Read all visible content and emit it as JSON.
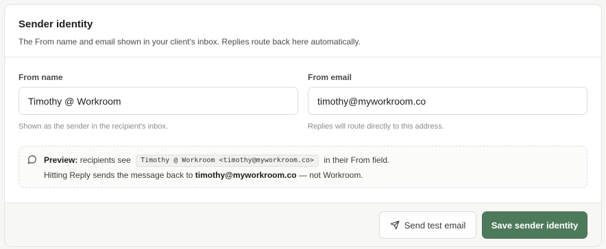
{
  "header": {
    "title": "Sender identity",
    "description": "The From name and email shown in your client's inbox. Replies route back here automatically."
  },
  "from_name": {
    "label": "From name",
    "value": "Timothy @ Workroom",
    "hint": "Shown as the sender in the recipient's inbox."
  },
  "from_email": {
    "label": "From email",
    "value": "timothy@myworkroom.co",
    "hint": "Replies will route directly to this address."
  },
  "preview": {
    "icon": "message-circle-icon",
    "lead": "Preview:",
    "text_before": "recipients see",
    "code": "Timothy @ Workroom <timothy@myworkroom.co>",
    "text_after": "in their From field.",
    "line2_before": "Hitting Reply sends the message back to",
    "line2_email": "timothy@myworkroom.co",
    "line2_after": "— not Workroom."
  },
  "footer": {
    "test_button": "Send test email",
    "test_icon": "send-icon",
    "save_button": "Save sender identity",
    "accent": "#4e7a5c"
  }
}
